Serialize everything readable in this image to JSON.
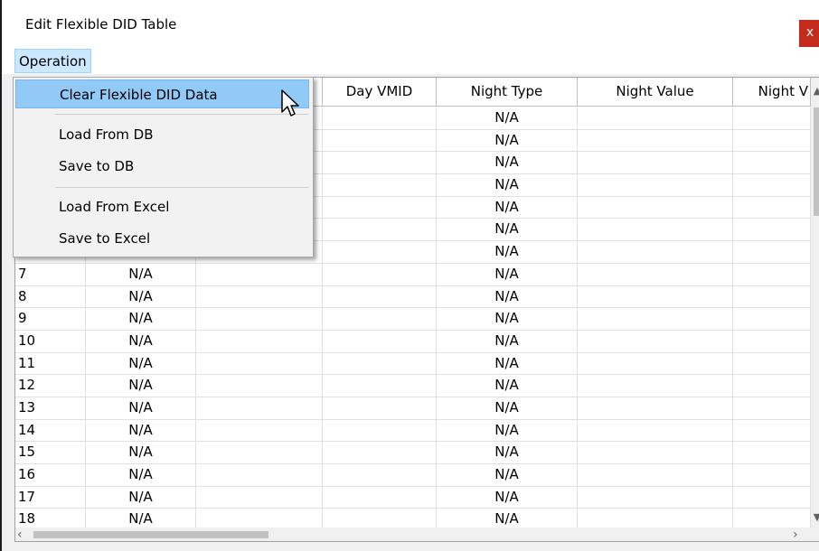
{
  "window": {
    "title": "Edit Flexible DID Table",
    "close_label": "x"
  },
  "menubar": {
    "operation_label": "Operation"
  },
  "menu": {
    "items": [
      {
        "label": "Clear Flexible DID Data"
      },
      {
        "label": "Load From DB"
      },
      {
        "label": "Save to DB"
      },
      {
        "label": "Load From Excel"
      },
      {
        "label": "Save to Excel"
      }
    ]
  },
  "table": {
    "headers": [
      "Day VMID",
      "Night Type",
      "Night Value",
      "Night V"
    ],
    "rows": [
      {
        "num": "",
        "type": "",
        "ntype": "N/A"
      },
      {
        "num": "",
        "type": "",
        "ntype": "N/A"
      },
      {
        "num": "",
        "type": "",
        "ntype": "N/A"
      },
      {
        "num": "",
        "type": "",
        "ntype": "N/A"
      },
      {
        "num": "",
        "type": "",
        "ntype": "N/A"
      },
      {
        "num": "",
        "type": "",
        "ntype": "N/A"
      },
      {
        "num": "",
        "type": "",
        "ntype": "N/A"
      },
      {
        "num": "7",
        "type": "N/A",
        "ntype": "N/A"
      },
      {
        "num": "8",
        "type": "N/A",
        "ntype": "N/A"
      },
      {
        "num": "9",
        "type": "N/A",
        "ntype": "N/A"
      },
      {
        "num": "10",
        "type": "N/A",
        "ntype": "N/A"
      },
      {
        "num": "11",
        "type": "N/A",
        "ntype": "N/A"
      },
      {
        "num": "12",
        "type": "N/A",
        "ntype": "N/A"
      },
      {
        "num": "13",
        "type": "N/A",
        "ntype": "N/A"
      },
      {
        "num": "14",
        "type": "N/A",
        "ntype": "N/A"
      },
      {
        "num": "15",
        "type": "N/A",
        "ntype": "N/A"
      },
      {
        "num": "16",
        "type": "N/A",
        "ntype": "N/A"
      },
      {
        "num": "17",
        "type": "N/A",
        "ntype": "N/A"
      },
      {
        "num": "18",
        "type": "N/A",
        "ntype": "N/A"
      }
    ]
  },
  "colors": {
    "close": "#c42b1c",
    "menu_highlight": "#91c9f7",
    "menubar_active": "#cce8ff"
  }
}
